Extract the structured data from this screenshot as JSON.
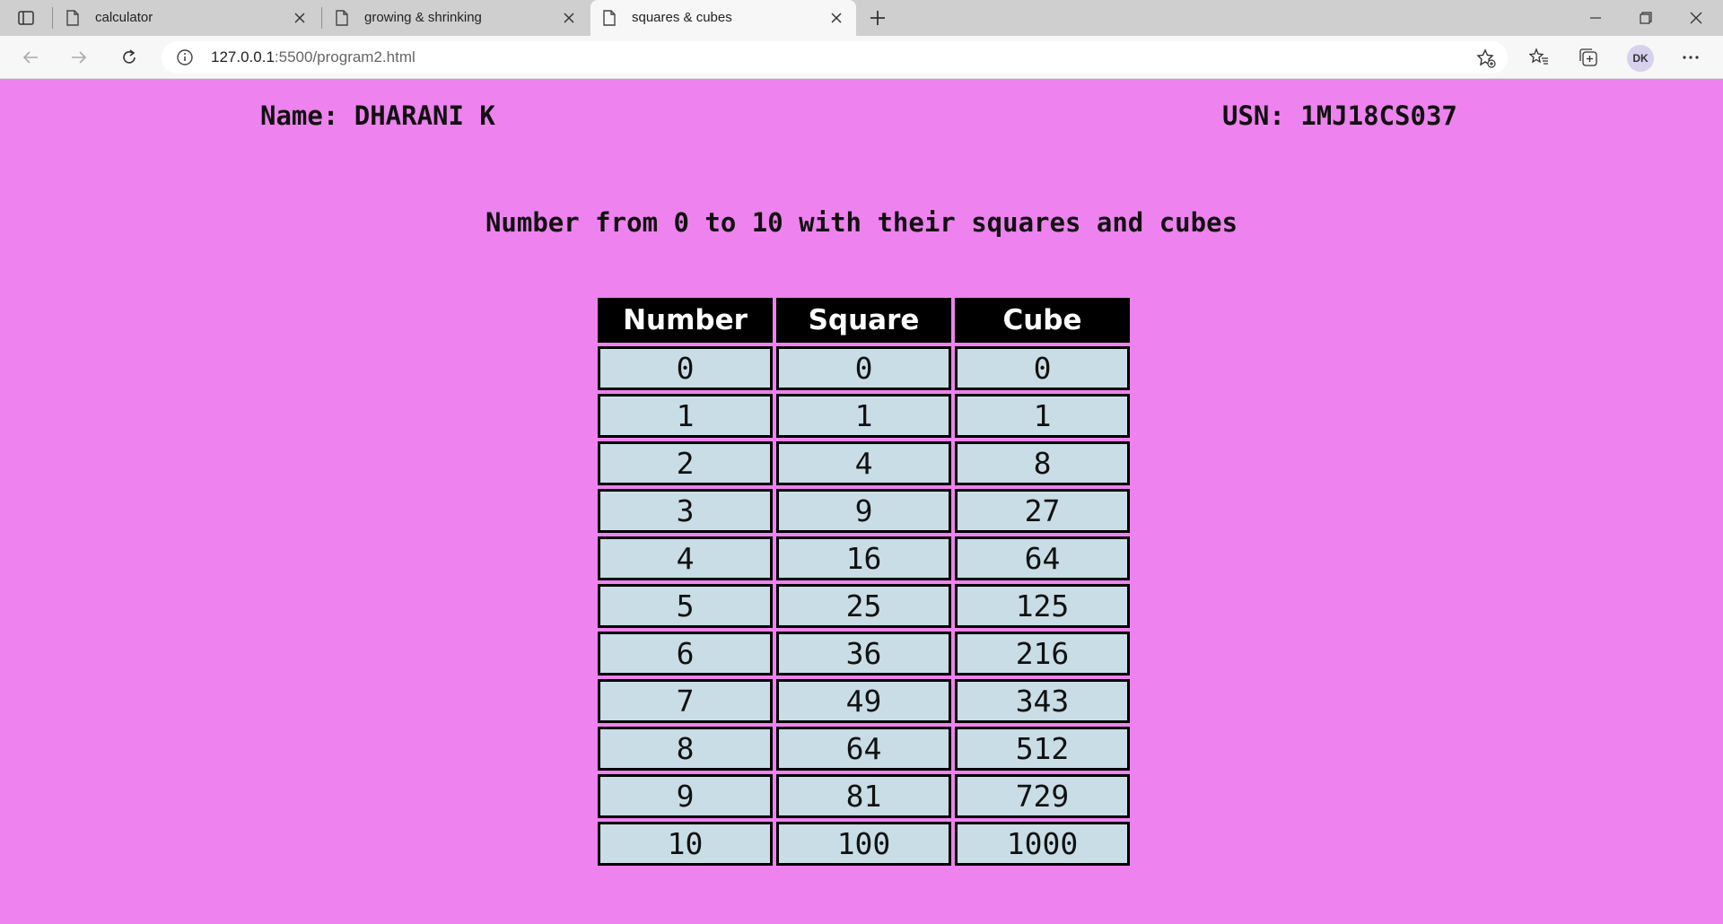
{
  "browser": {
    "tabs": [
      {
        "title": "calculator"
      },
      {
        "title": "growing & shrinking"
      },
      {
        "title": "squares & cubes"
      }
    ],
    "address": {
      "host": "127.0.0.1",
      "path": ":5500/program2.html"
    },
    "profile_initials": "DK"
  },
  "page": {
    "name_label": "Name: DHARANI K",
    "usn_label": "USN: 1MJ18CS037",
    "heading": "Number from 0 to 10 with their squares and cubes",
    "table": {
      "headers": [
        "Number",
        "Square",
        "Cube"
      ],
      "rows": [
        [
          "0",
          "0",
          "0"
        ],
        [
          "1",
          "1",
          "1"
        ],
        [
          "2",
          "4",
          "8"
        ],
        [
          "3",
          "9",
          "27"
        ],
        [
          "4",
          "16",
          "64"
        ],
        [
          "5",
          "25",
          "125"
        ],
        [
          "6",
          "36",
          "216"
        ],
        [
          "7",
          "49",
          "343"
        ],
        [
          "8",
          "64",
          "512"
        ],
        [
          "9",
          "81",
          "729"
        ],
        [
          "10",
          "100",
          "1000"
        ]
      ]
    }
  },
  "colors": {
    "page_background": "#ee82ee",
    "header_cell": "#000000",
    "data_cell": "#c8dde5"
  }
}
